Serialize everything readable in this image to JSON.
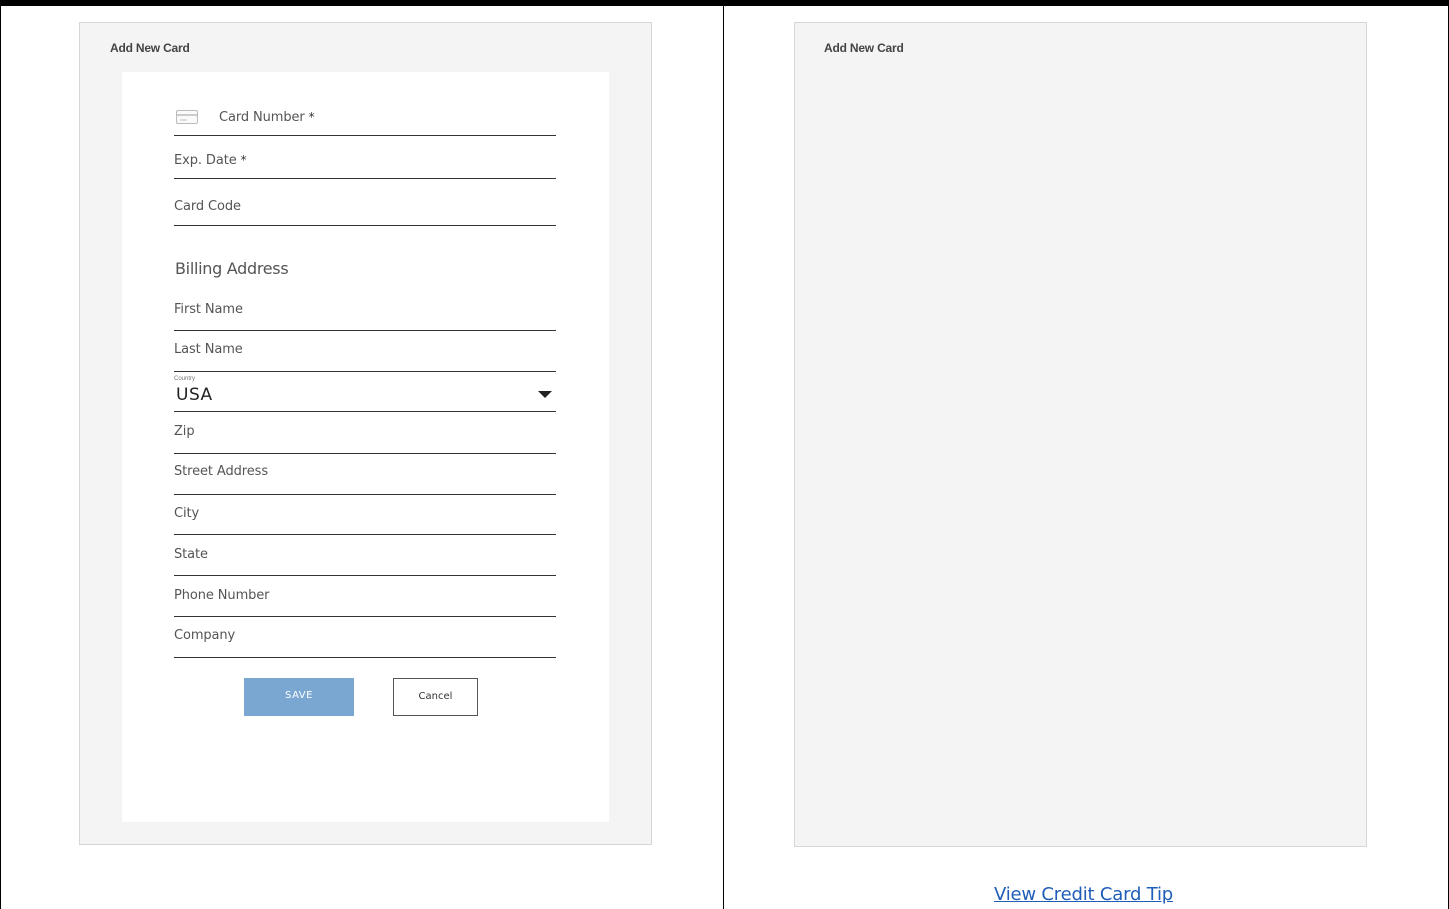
{
  "left_panel": {
    "title": "Add New Card",
    "fields": {
      "card_number": "Card Number",
      "exp_date": "Exp. Date",
      "card_code": "Card Code",
      "first_name": "First Name",
      "last_name": "Last Name",
      "country_label": "Country",
      "country_value": "USA",
      "zip": "Zip",
      "street": "Street Address",
      "city": "City",
      "state": "State",
      "phone": "Phone Number",
      "company": "Company"
    },
    "required_mark": "*",
    "billing_title": "Billing Address",
    "save_label": "SAVE",
    "cancel_label": "Cancel"
  },
  "right_panel": {
    "title": "Add New Card",
    "tip_link": "View Credit Card Tip"
  },
  "colors": {
    "save_button": "#7aa7d2",
    "link": "#1f5db8",
    "panel_bg": "#f4f4f4"
  }
}
